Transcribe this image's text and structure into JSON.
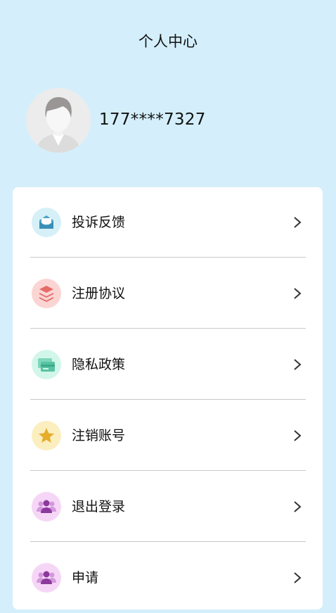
{
  "header": {
    "title": "个人中心"
  },
  "profile": {
    "phone": "177****7327"
  },
  "menu": {
    "items": [
      {
        "label": "投诉反馈",
        "icon": "envelope-icon",
        "icon_bg": "#d6f0f8",
        "icon_color": "#4aa3c8"
      },
      {
        "label": "注册协议",
        "icon": "layers-icon",
        "icon_bg": "#fbd5d3",
        "icon_color": "#e66a66"
      },
      {
        "label": "隐私政策",
        "icon": "cards-icon",
        "icon_bg": "#d3f6ea",
        "icon_color": "#56c4a3"
      },
      {
        "label": "注销账号",
        "icon": "star-icon",
        "icon_bg": "#fbefc0",
        "icon_color": "#e5ad2a"
      },
      {
        "label": "退出登录",
        "icon": "users-icon",
        "icon_bg": "#f6d6f7",
        "icon_color": "#b25ac2"
      },
      {
        "label": "申请",
        "icon": "users-icon",
        "icon_bg": "#f6d6f7",
        "icon_color": "#b25ac2"
      }
    ]
  },
  "colors": {
    "background": "#d4effb",
    "card": "#ffffff",
    "divider": "#c9c9c9"
  }
}
